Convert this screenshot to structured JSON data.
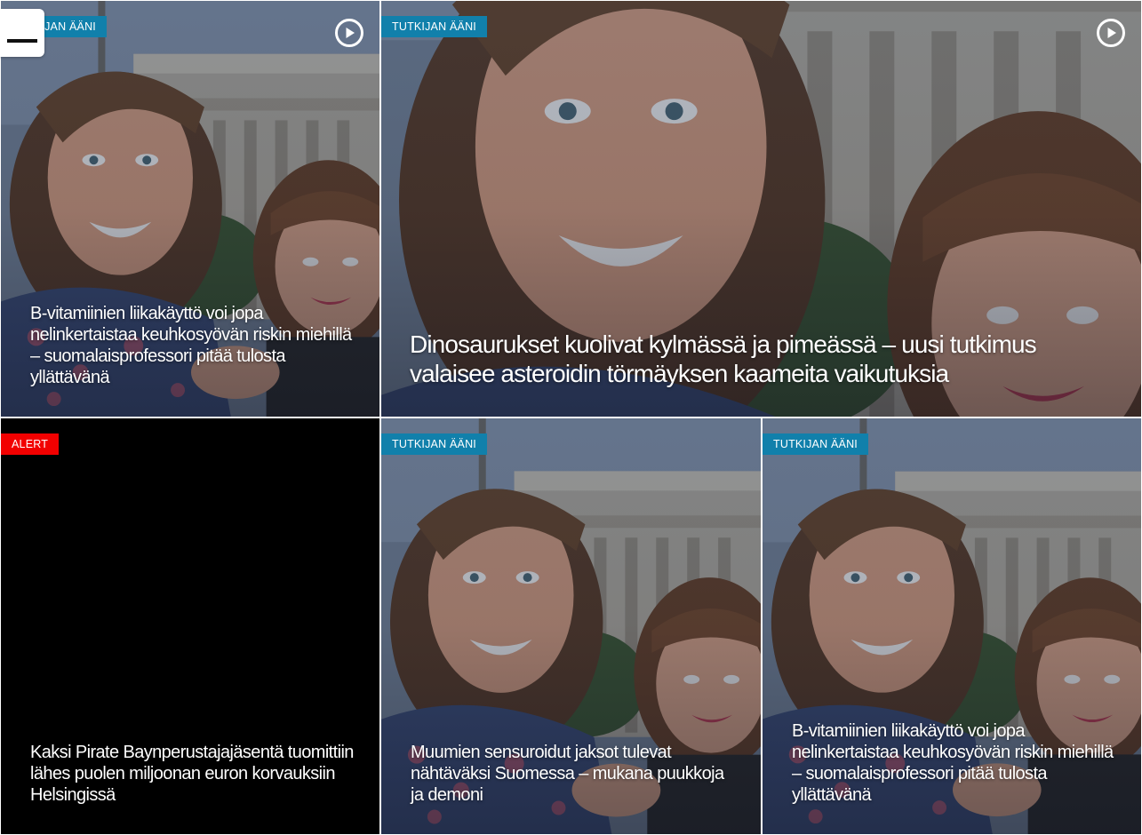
{
  "menu": {
    "icon": "hamburger-menu-icon"
  },
  "tiles": [
    {
      "badge": "TUTKIJAN ÄÄNI",
      "badge_color": "#1180ab",
      "headline": "B-vitamiinien liikakäyttö voi jopa nelinkertaistaa keuhkosyövän riskin miehillä – suomalaisprofessori pitää tulosta yllättävänä",
      "has_video": true
    },
    {
      "badge": "TUTKIJAN ÄÄNI",
      "badge_color": "#1180ab",
      "headline": "Dinosaurukset kuolivat kylmässä ja pimeässä – uusi tutkimus valaisee asteroidin törmäyksen kaameita vaikutuksia",
      "has_video": true
    },
    {
      "badge": "ALERT",
      "badge_color": "#f20000",
      "headline": "Kaksi Pirate Baynperustajajäsentä tuomittiin lähes puolen miljoonan euron korvauksiin Helsingissä",
      "has_video": false
    },
    {
      "badge": "TUTKIJAN ÄÄNI",
      "badge_color": "#1180ab",
      "headline": "Muumien sensuroidut jaksot tulevat nähtäväksi Suomessa – mukana puukkoja ja demoni",
      "has_video": false
    },
    {
      "badge": "TUTKIJAN ÄÄNI",
      "badge_color": "#1180ab",
      "headline": "B-vitamiinien liikakäyttö voi jopa nelinkertaistaa keuhkosyövän riskin miehillä – suomalaisprofessori pitää tulosta yllättävänä",
      "has_video": false
    }
  ]
}
